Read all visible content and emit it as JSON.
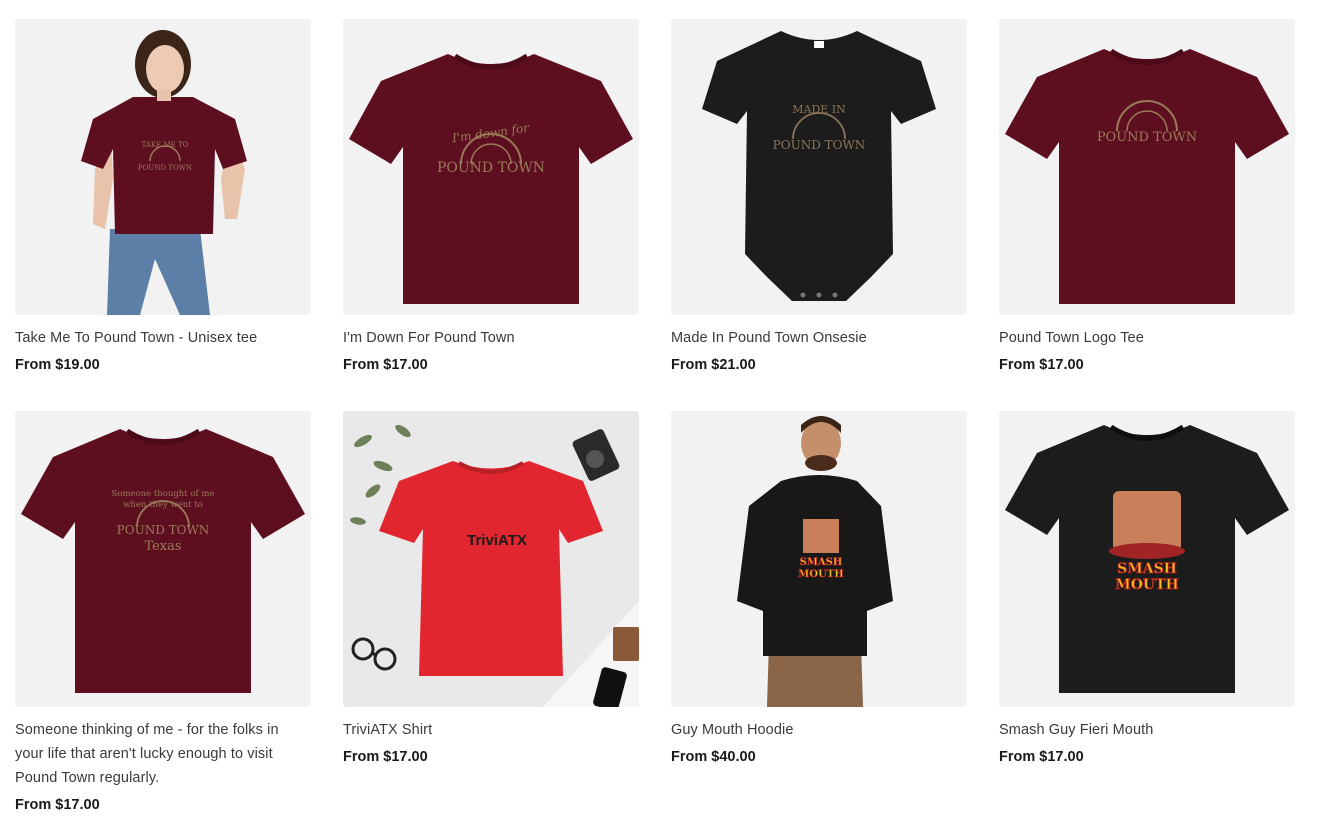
{
  "products": [
    {
      "title": "Take Me To Pound Town - Unisex tee",
      "price": "From $19.00",
      "image": {
        "kind": "model-tee",
        "print_lines": [
          "TAKE ME TO",
          "POUND TOWN"
        ]
      }
    },
    {
      "title": "I'm Down For Pound Town",
      "price": "From $17.00",
      "image": {
        "kind": "tee",
        "print_lines": [
          "I'm down for",
          "POUND TOWN"
        ]
      }
    },
    {
      "title": "Made In Pound Town Onsesie",
      "price": "From $21.00",
      "image": {
        "kind": "onesie",
        "print_lines": [
          "MADE IN",
          "POUND TOWN"
        ]
      }
    },
    {
      "title": "Pound Town Logo Tee",
      "price": "From $17.00",
      "image": {
        "kind": "tee",
        "print_lines": [
          "POUND TOWN"
        ]
      }
    },
    {
      "title": "Someone thinking of me - for the folks in your life that aren't lucky enough to visit Pound Town regularly.",
      "price": "From $17.00",
      "image": {
        "kind": "tee",
        "print_lines": [
          "Someone thought of me",
          "when they went to",
          "POUND TOWN",
          "Texas"
        ]
      }
    },
    {
      "title": "TriviATX Shirt",
      "price": "From $17.00",
      "image": {
        "kind": "flatlay-tee",
        "print_lines": [
          "TriviATX"
        ]
      }
    },
    {
      "title": "Guy Mouth Hoodie",
      "price": "From $40.00",
      "image": {
        "kind": "model-hoodie",
        "print_lines": [
          "SMASH",
          "MOUTH"
        ]
      }
    },
    {
      "title": "Smash Guy Fieri Mouth",
      "price": "From $17.00",
      "image": {
        "kind": "tee",
        "print_lines": [
          "SMASH",
          "MOUTH"
        ]
      }
    }
  ],
  "colors": {
    "maroon": "#5e0f1f",
    "black": "#1c1c1c",
    "red": "#e2262f",
    "print_tan": "#9a7a5a",
    "card_bg": "#f2f2f2"
  }
}
